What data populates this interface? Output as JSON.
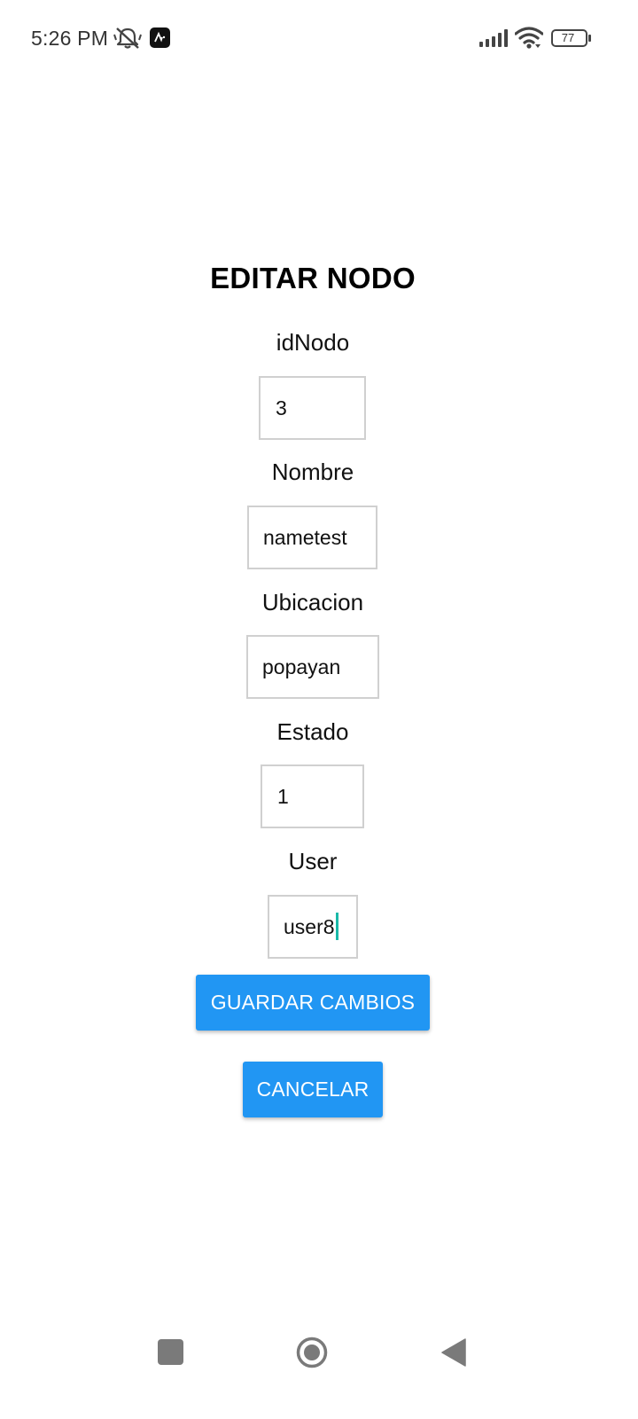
{
  "status_bar": {
    "time": "5:26 PM",
    "battery_level": "77",
    "icons": [
      "mute-icon",
      "app-notification-icon",
      "signal-icon",
      "wifi-icon",
      "battery-icon"
    ]
  },
  "form": {
    "title": "EDITAR NODO",
    "fields": [
      {
        "label": "idNodo",
        "value": "3"
      },
      {
        "label": "Nombre",
        "value": "nametest"
      },
      {
        "label": "Ubicacion",
        "value": "popayan"
      },
      {
        "label": "Estado",
        "value": "1"
      },
      {
        "label": "User",
        "value": "user8"
      }
    ],
    "save_label": "GUARDAR CAMBIOS",
    "cancel_label": "CANCELAR"
  },
  "nav_bar": {
    "icons": [
      "recents-square-icon",
      "home-circle-icon",
      "back-triangle-icon"
    ]
  },
  "colors": {
    "button": "#2196f3",
    "caret": "#1ab9a8",
    "input_border": "#d0d0d0"
  }
}
